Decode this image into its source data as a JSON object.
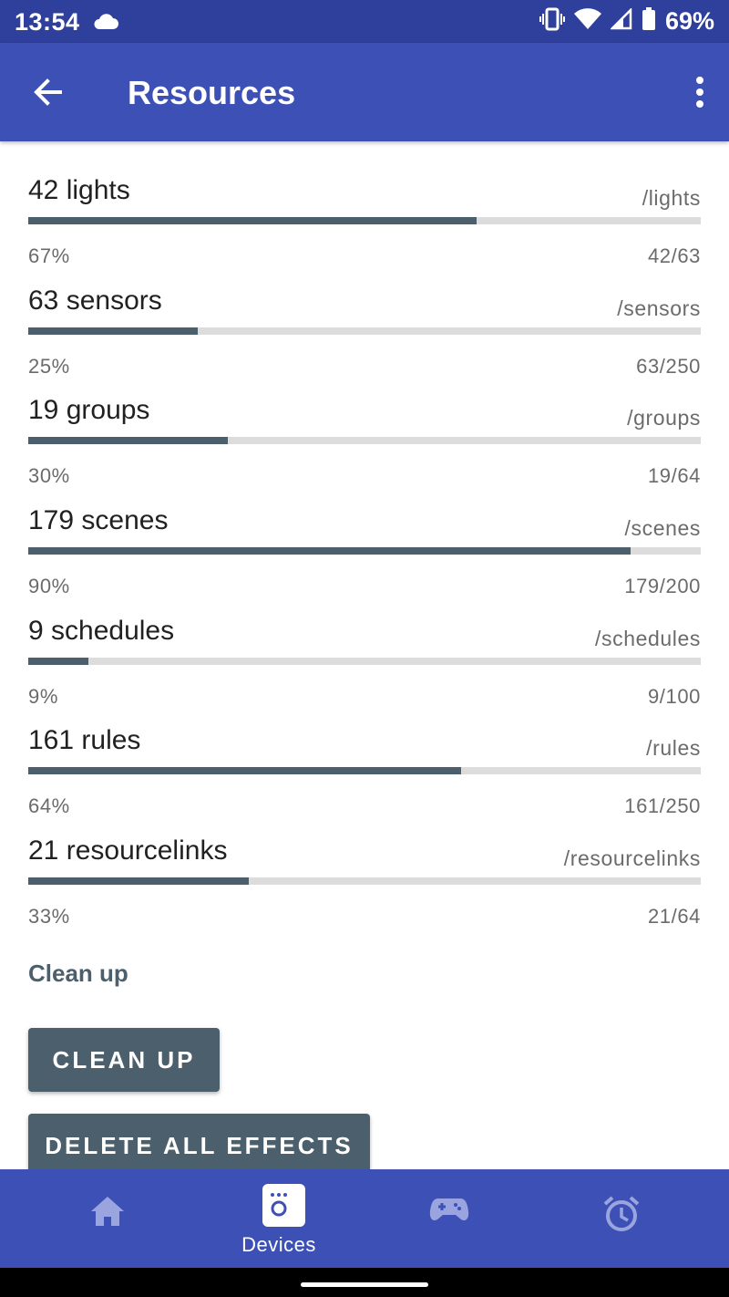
{
  "status_bar": {
    "time": "13:54",
    "battery": "69%",
    "icons": [
      "cloud-icon",
      "vibrate-icon",
      "wifi-icon",
      "signal-icon",
      "battery-icon"
    ]
  },
  "app_bar": {
    "title": "Resources",
    "back_icon": "arrow-left-icon",
    "menu_icon": "more-vert-icon"
  },
  "resources": [
    {
      "name": "42 lights",
      "path": "/lights",
      "percent_label": "67%",
      "ratio": "42/63",
      "fraction": 0.667
    },
    {
      "name": "63 sensors",
      "path": "/sensors",
      "percent_label": "25%",
      "ratio": "63/250",
      "fraction": 0.252
    },
    {
      "name": "19 groups",
      "path": "/groups",
      "percent_label": "30%",
      "ratio": "19/64",
      "fraction": 0.297
    },
    {
      "name": "179 scenes",
      "path": "/scenes",
      "percent_label": "90%",
      "ratio": "179/200",
      "fraction": 0.895
    },
    {
      "name": "9 schedules",
      "path": "/schedules",
      "percent_label": "9%",
      "ratio": "9/100",
      "fraction": 0.09
    },
    {
      "name": "161 rules",
      "path": "/rules",
      "percent_label": "64%",
      "ratio": "161/250",
      "fraction": 0.644
    },
    {
      "name": "21 resourcelinks",
      "path": "/resourcelinks",
      "percent_label": "33%",
      "ratio": "21/64",
      "fraction": 0.328
    }
  ],
  "cleanup_section": {
    "title": "Clean up",
    "cleanup_button": "CLEAN UP",
    "delete_effects_button": "DELETE ALL EFFECTS"
  },
  "bottom_nav": {
    "items": [
      {
        "icon": "home-icon",
        "label": ""
      },
      {
        "icon": "devices-icon",
        "label": "Devices",
        "active": true
      },
      {
        "icon": "gamepad-icon",
        "label": ""
      },
      {
        "icon": "alarm-icon",
        "label": ""
      }
    ]
  },
  "colors": {
    "status_bar": "#2f3f9c",
    "app_bar": "#3d50b5",
    "progress_fill": "#4b5f6c",
    "progress_track": "#dcdcdc",
    "button": "#4b5f6c",
    "nav_inactive_icon": "#9aa5e0"
  }
}
